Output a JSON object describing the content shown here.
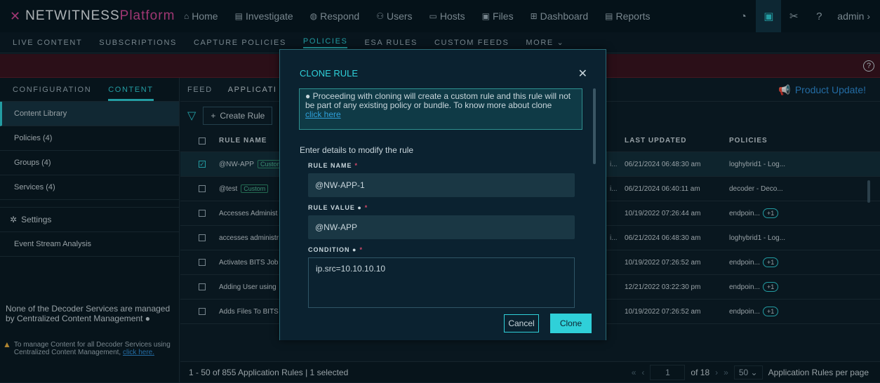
{
  "app": {
    "brand_a": "NETWITNESS",
    "brand_b": "Platform",
    "user": "admin"
  },
  "nav": {
    "items": [
      "Home",
      "Investigate",
      "Respond",
      "Users",
      "Hosts",
      "Files",
      "Dashboard",
      "Reports"
    ]
  },
  "subnav": {
    "items": [
      "LIVE CONTENT",
      "SUBSCRIPTIONS",
      "CAPTURE POLICIES",
      "POLICIES",
      "ESA RULES",
      "CUSTOM FEEDS",
      "MORE"
    ]
  },
  "sidebar": {
    "tabs": [
      "CONFIGURATION",
      "CONTENT"
    ],
    "items": [
      "Content Library",
      "Policies (4)",
      "Groups (4)",
      "Services (4)"
    ],
    "settings": "Settings",
    "esa": "Event Stream Analysis",
    "note": "None of the Decoder Services are managed by Centralized Content Management",
    "warn_text": "To manage Content for all Decoder Services using Centralized Content Management,",
    "warn_link": "click here."
  },
  "main": {
    "tabs": [
      "FEED",
      "APPLICATI"
    ],
    "product_update": "Product Update!",
    "create_rule": "Create Rule",
    "columns": {
      "name": "RULE NAME",
      "updated": "LAST UPDATED",
      "policies": "POLICIES"
    },
    "custom_tag": "Custom",
    "rows": [
      {
        "name": "@NW-APP",
        "tag": true,
        "dots": "i...",
        "updated": "06/21/2024 06:48:30 am",
        "policy": "loghybrid1 - Log...",
        "plus": ""
      },
      {
        "name": "@test",
        "tag": true,
        "dots": "i...",
        "updated": "06/21/2024 06:40:11 am",
        "policy": "decoder - Deco...",
        "plus": ""
      },
      {
        "name": "Accesses Administ",
        "tag": false,
        "dots": "",
        "updated": "10/19/2022 07:26:44 am",
        "policy": "endpoin...",
        "plus": "+1"
      },
      {
        "name": "accesses administr",
        "tag": false,
        "dots": "i...",
        "updated": "06/21/2024 06:48:30 am",
        "policy": "loghybrid1 - Log...",
        "plus": ""
      },
      {
        "name": "Activates BITS Job",
        "tag": false,
        "dots": "",
        "updated": "10/19/2022 07:26:52 am",
        "policy": "endpoin...",
        "plus": "+1"
      },
      {
        "name": "Adding User using",
        "tag": false,
        "dots": "",
        "updated": "12/21/2022 03:22:30 pm",
        "policy": "endpoin...",
        "plus": "+1"
      },
      {
        "name": "Adds Files To BITS",
        "tag": false,
        "dots": "",
        "updated": "10/19/2022 07:26:52 am",
        "policy": "endpoin...",
        "plus": "+1"
      }
    ],
    "footer": {
      "summary": "1 - 50 of 855 Application Rules | 1 selected",
      "page": "1",
      "of": "of 18",
      "size": "50",
      "per_page": "Application Rules per page"
    }
  },
  "modal": {
    "title": "CLONE RULE",
    "info": "Proceeding with cloning will create a custom rule and this rule will not be part of any existing policy or bundle. To know more about clone",
    "info_link": "click here",
    "subtitle": "Enter details to modify the rule",
    "rule_name_label": "RULE NAME",
    "rule_name": "@NW-APP-1",
    "rule_value_label": "RULE VALUE",
    "rule_value": "@NW-APP",
    "condition_label": "CONDITION",
    "condition": "ip.src=10.10.10.10",
    "cancel": "Cancel",
    "clone": "Clone"
  }
}
